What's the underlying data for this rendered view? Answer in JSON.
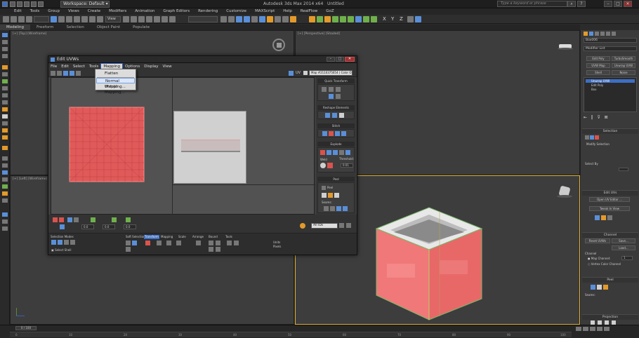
{
  "window": {
    "workspace": "Workspace: Default",
    "title_app": "Autodesk 3ds Max 2014 x64",
    "title_file": "Untitled",
    "search_placeholder": "Type a keyword or phrase"
  },
  "menubar": [
    "Edit",
    "Tools",
    "Group",
    "Views",
    "Create",
    "Modifiers",
    "Animation",
    "Graph Editors",
    "Rendering",
    "Customize",
    "MAXScript",
    "Help",
    "RealFlow",
    "GoZ"
  ],
  "toolbar": {
    "coord_system": "View",
    "axis_labels": [
      "X",
      "Y",
      "Z"
    ]
  },
  "ribbon": {
    "tabs": [
      "Modeling",
      "Freeform",
      "Selection",
      "Object Paint",
      "Populate"
    ]
  },
  "viewports": {
    "top": "[+] [Top] [Wireframe]",
    "perspective": "[+] [Perspective] [Shaded]",
    "left": "[+] [Left] [Wireframe]"
  },
  "command_panel": {
    "object_name": "Box006",
    "modifier_list": "Modifier List",
    "buttons_row1": [
      "Edit Poly",
      "TurboSmooth"
    ],
    "buttons_row2": [
      "UVW Map",
      "Unwrap UVW"
    ],
    "buttons_row3": [
      "Shell",
      "Noise"
    ],
    "stack": [
      "Unwrap UVW",
      "Edit Poly",
      "Box"
    ],
    "rollouts": [
      "Selection",
      "Edit UVs",
      "Channel",
      "Peel",
      "Projection"
    ],
    "modify_selection": "Modify Selection",
    "select_by": "Select By",
    "open_uv_editor": "Open UV Editor ...",
    "tweak_in_view": "Tweak In View",
    "reset_uvws": "Reset UVWs",
    "save": "Save...",
    "load": "Load...",
    "channel_label": "Channel",
    "map_channel": "Map Channel:",
    "map_channel_value": "1",
    "vertex_color_channel": "Vertex Color Channel",
    "seams": "Seams:"
  },
  "dialog": {
    "title": "Edit UVWs",
    "menu": [
      "File",
      "Edit",
      "Select",
      "Tools",
      "Mapping",
      "Options",
      "Display",
      "View"
    ],
    "uv_label": "UV",
    "map_dropdown": "Map #2110375654 ( Color O)",
    "mapping_menu": [
      "Flatten Mapping...",
      "Normal Mapping...",
      "Unfold Mapping..."
    ],
    "side_sections": [
      "Quick Transform",
      "Reshape Elements",
      "Stitch",
      "Explode",
      "Peel"
    ],
    "weld_label": "Weld",
    "threshold_label": "Threshold:",
    "threshold_value": "0.01",
    "seams_label": "Seams:",
    "bottom_fields": [
      "0.0",
      "0.0",
      "0.0"
    ],
    "all_ids": "All IDs",
    "footer_tabs": [
      "Selection Modes",
      "Soft Selection",
      "Rotate",
      "Transform",
      "Mapping",
      "Scale",
      "Arrange",
      "Bound",
      "Tools"
    ],
    "select_shell": "Select Shell",
    "units": "Units",
    "pixels": "Pixels"
  },
  "timeline": {
    "frame": "0 / 100",
    "ticks": [
      "0",
      "10",
      "20",
      "30",
      "40",
      "50",
      "60",
      "70",
      "80",
      "90",
      "100"
    ]
  },
  "colors": {
    "accent_blue": "#3c6fc4",
    "mesh_red": "#e05a5a",
    "cube_red": "#f07878",
    "uv_gray": "#d0d0d0"
  }
}
